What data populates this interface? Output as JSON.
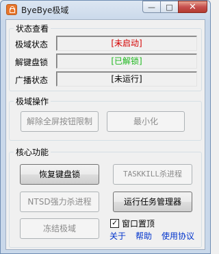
{
  "window": {
    "title": "ByeBye极域"
  },
  "caption": {
    "minimize": "—",
    "maximize": "□",
    "close": "✕"
  },
  "status_group": {
    "label": "状态查看",
    "rows": [
      {
        "label": "极域状态",
        "value": "[未启动]",
        "color": "#d40000"
      },
      {
        "label": "解键盘锁",
        "value": "[已解锁]",
        "color": "#1fb81f"
      },
      {
        "label": "广播状态",
        "value": "[未运行]",
        "color": "#000000"
      }
    ]
  },
  "ops_group": {
    "label": "极域操作",
    "unlock_fullscreen": "解除全屏按钮限制",
    "minimize": "最小化"
  },
  "core_group": {
    "label": "核心功能",
    "restore_keyboard_lock": "恢复键盘锁",
    "taskkill": "TASKKILL杀进程",
    "ntsd": "NTSD强力杀进程",
    "run_task_manager": "运行任务管理器",
    "freeze": "冻结极域",
    "topmost_label": "窗口置顶",
    "topmost_checked": true,
    "links": [
      "关于",
      "帮助",
      "使用协议"
    ]
  }
}
